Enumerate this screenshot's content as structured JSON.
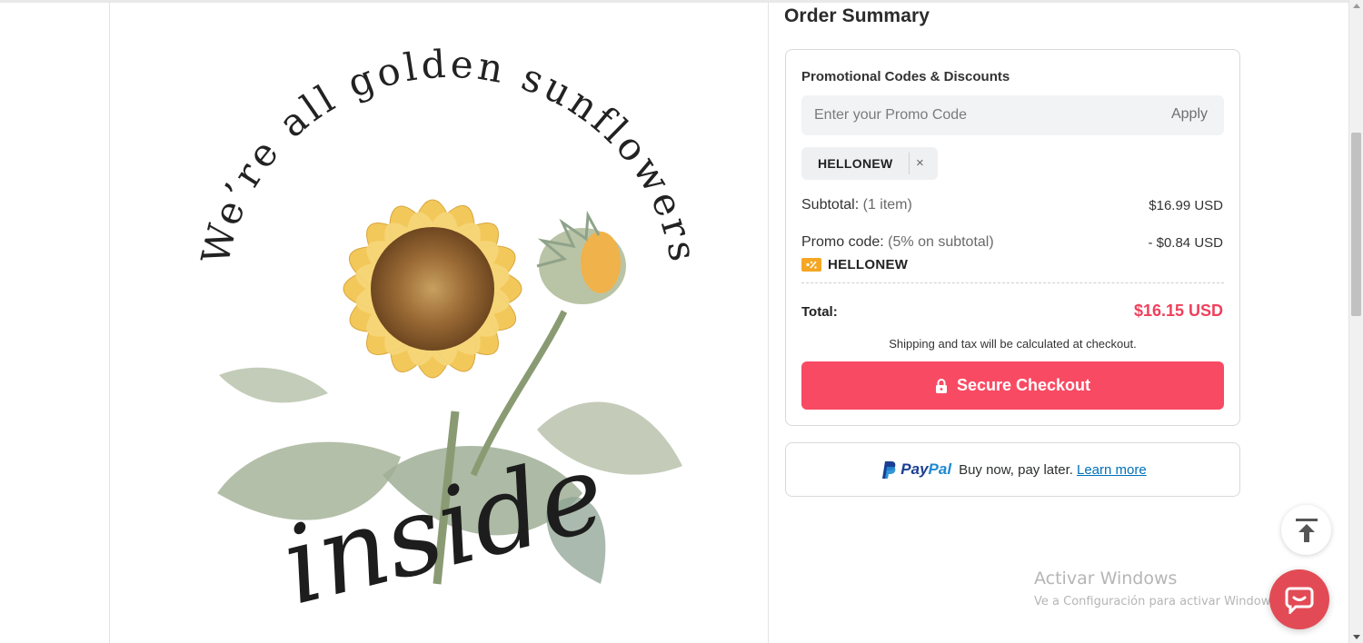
{
  "product": {
    "artwork": {
      "arc_text": "We’re all golden sunflowers",
      "script_text": "inside"
    }
  },
  "order_summary": {
    "title": "Order Summary",
    "promo": {
      "heading": "Promotional Codes & Discounts",
      "placeholder": "Enter your Promo Code",
      "apply_label": "Apply",
      "applied_chip": "HELLONEW",
      "remove_icon": "×"
    },
    "subtotal": {
      "label": "Subtotal:",
      "detail": "(1 item)",
      "value": "$16.99 USD"
    },
    "promo_code": {
      "label": "Promo code:",
      "detail": "(5% on subtotal)",
      "value": "- $0.84 USD",
      "code": "HELLONEW",
      "icon": "discount-tag-icon"
    },
    "total": {
      "label": "Total:",
      "value": "$16.15 USD"
    },
    "shipping_note": "Shipping and tax will be calculated at checkout.",
    "checkout": {
      "label": "Secure Checkout",
      "icon": "lock-icon",
      "color": "#f94a63"
    }
  },
  "paypal": {
    "brand_pay": "Pay",
    "brand_pal": "Pal",
    "message": "Buy now, pay later.",
    "learn_more": "Learn more"
  },
  "floating": {
    "back_to_top_icon": "arrow-up-to-line-icon",
    "chat_icon": "chat-bubble-icon",
    "chat_color": "#e24b55"
  },
  "watermark": {
    "title": "Activar Windows",
    "subtitle": "Ve a Configuración para activar Windows."
  },
  "colors": {
    "accent": "#f94a63",
    "total_red": "#f0405c",
    "paypal_dark": "#1a3f92",
    "paypal_light": "#1f8ad3"
  }
}
